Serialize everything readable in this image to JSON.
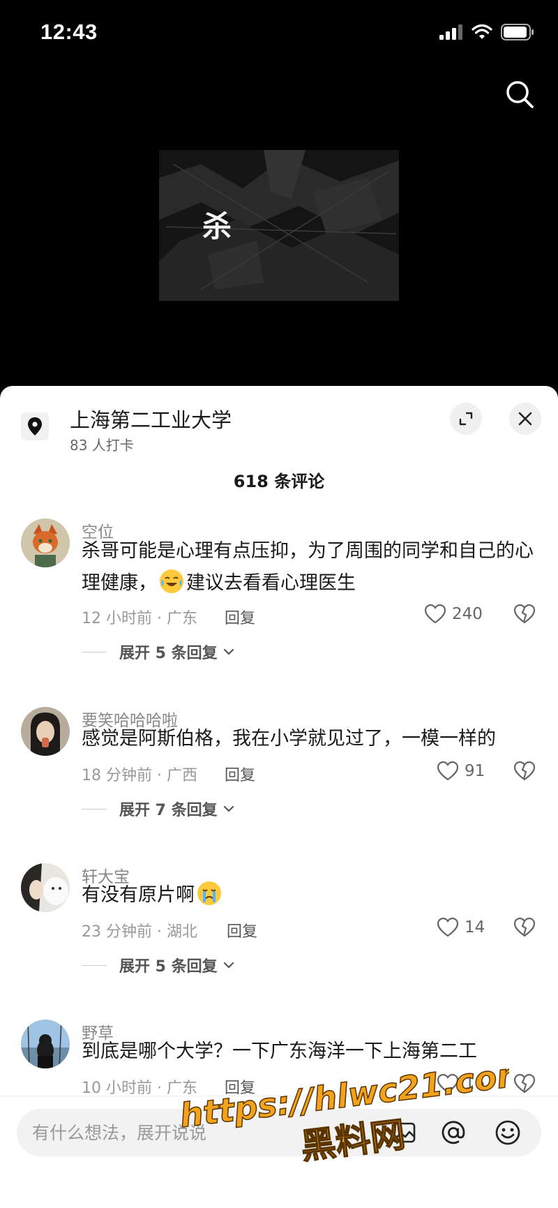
{
  "status_bar": {
    "time": "12:43"
  },
  "video": {
    "overlay_char": "杀"
  },
  "location": {
    "title": "上海第二工业大学",
    "checkins": "83 人打卡"
  },
  "comments_header": {
    "count_label": "618 条评论"
  },
  "reply_label": "回复",
  "comments": [
    {
      "user": "空位",
      "text_before": "杀哥可能是心理有点压抑，为了周围的同学和自己的心理健康，",
      "text_after": "建议去看看心理医生",
      "meta": "12 小时前 · 广东",
      "likes": "240",
      "expand": "展开 5 条回复"
    },
    {
      "user": "要笑哈哈哈啦",
      "text": "感觉是阿斯伯格，我在小学就见过了，一模一样的",
      "meta": "18 分钟前 · 广西",
      "likes": "91",
      "expand": "展开 7 条回复"
    },
    {
      "user": "轩大宝",
      "text": "有没有原片啊",
      "meta": "23 分钟前 · 湖北",
      "likes": "14",
      "expand": "展开 5 条回复"
    },
    {
      "user": "野草",
      "text": "到底是哪个大学？一下广东海洋一下上海第二工",
      "meta": "10 小时前 · 广东",
      "likes": "16"
    }
  ],
  "input": {
    "placeholder": "有什么想法，展开说说"
  },
  "watermark": {
    "line1": "https://hlwc21.com",
    "line2": "黑料网"
  },
  "icons": [
    "search-icon",
    "location-pin-icon",
    "expand-icon",
    "close-icon",
    "heart-icon",
    "broken-heart-icon",
    "chevron-down-icon",
    "image-icon",
    "at-icon",
    "emoji-icon"
  ]
}
